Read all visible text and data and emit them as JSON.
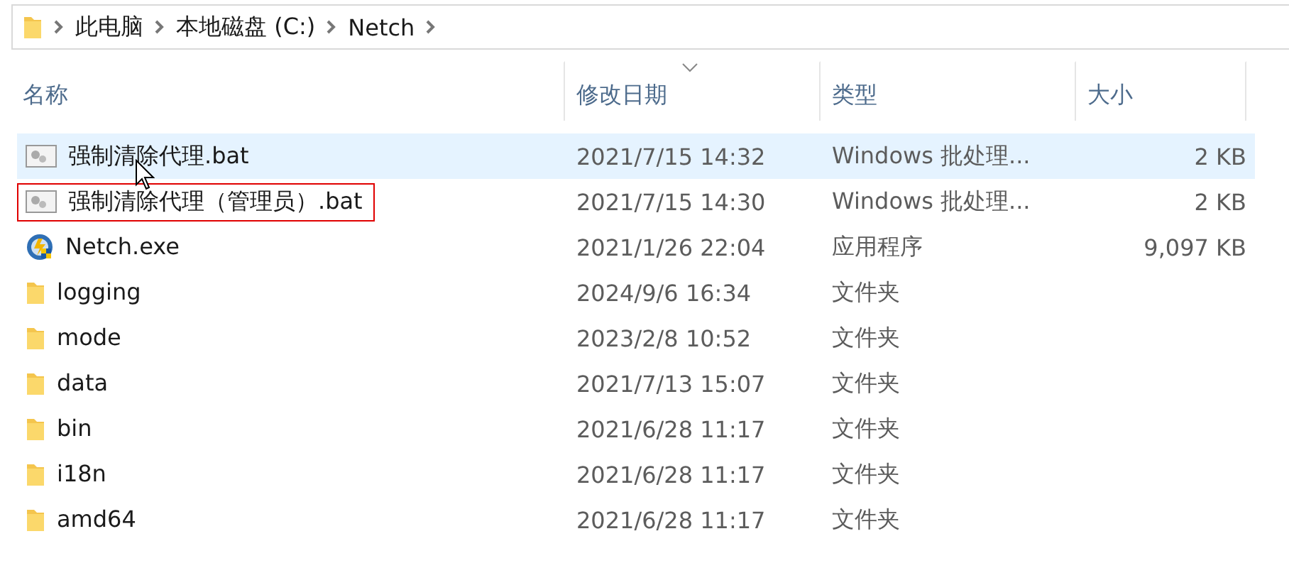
{
  "breadcrumb": [
    "此电脑",
    "本地磁盘 (C:)",
    "Netch"
  ],
  "columns": [
    {
      "label": "名称",
      "sorted": false
    },
    {
      "label": "修改日期",
      "sorted": true
    },
    {
      "label": "类型",
      "sorted": false
    },
    {
      "label": "大小",
      "sorted": false
    }
  ],
  "rows": [
    {
      "kind": "bat",
      "name": "强制清除代理.bat",
      "date": "2021/7/15 14:32",
      "type": "Windows 批处理...",
      "size": "2 KB",
      "highlighted": true,
      "outlined": false
    },
    {
      "kind": "bat",
      "name": "强制清除代理（管理员）.bat",
      "date": "2021/7/15 14:30",
      "type": "Windows 批处理...",
      "size": "2 KB",
      "highlighted": false,
      "outlined": true
    },
    {
      "kind": "exe",
      "name": "Netch.exe",
      "date": "2021/1/26 22:04",
      "type": "应用程序",
      "size": "9,097 KB",
      "highlighted": false,
      "outlined": false
    },
    {
      "kind": "folder",
      "name": "logging",
      "date": "2024/9/6 16:34",
      "type": "文件夹",
      "highlighted": false,
      "outlined": false
    },
    {
      "kind": "folder",
      "name": "mode",
      "date": "2023/2/8 10:52",
      "type": "文件夹",
      "highlighted": false,
      "outlined": false
    },
    {
      "kind": "folder",
      "name": "data",
      "date": "2021/7/13 15:07",
      "type": "文件夹",
      "highlighted": false,
      "outlined": false
    },
    {
      "kind": "folder",
      "name": "bin",
      "date": "2021/6/28 11:17",
      "type": "文件夹",
      "highlighted": false,
      "outlined": false
    },
    {
      "kind": "folder",
      "name": "i18n",
      "date": "2021/6/28 11:17",
      "type": "文件夹",
      "highlighted": false,
      "outlined": false
    },
    {
      "kind": "folder",
      "name": "amd64",
      "date": "2021/6/28 11:17",
      "type": "文件夹",
      "highlighted": false,
      "outlined": false
    }
  ]
}
